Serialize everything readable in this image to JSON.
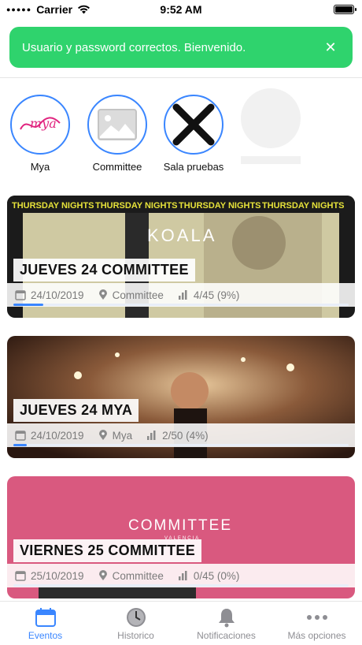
{
  "status_bar": {
    "carrier": "Carrier",
    "time": "9:52 AM"
  },
  "toast": {
    "message": "Usuario y password correctos. Bienvenido.",
    "close_icon": "close-icon"
  },
  "venues": [
    {
      "label": "Mya",
      "logo_text": "mya"
    },
    {
      "label": "Committee"
    },
    {
      "label": "Sala pruebas"
    }
  ],
  "events": [
    {
      "title": "JUEVES 24 COMMITTEE",
      "date": "24/10/2019",
      "venue": "Committee",
      "attendance": "4/45 (9%)",
      "progress": 0.09,
      "banner_text": "THURSDAY NIGHTS",
      "brand": "KOALA"
    },
    {
      "title": "JUEVES 24 MYA",
      "date": "24/10/2019",
      "venue": "Mya",
      "attendance": "2/50 (4%)",
      "progress": 0.04
    },
    {
      "title": "VIERNES 25 COMMITTEE",
      "date": "25/10/2019",
      "venue": "Committee",
      "attendance": "0/45 (0%)",
      "progress": 0.0,
      "brand": "COMMITTEE",
      "brand_sub": "VALENCIA"
    }
  ],
  "tabs": [
    {
      "label": "Eventos",
      "icon": "calendar-icon",
      "active": true
    },
    {
      "label": "Historico",
      "icon": "clock-icon",
      "active": false
    },
    {
      "label": "Notificaciones",
      "icon": "bell-icon",
      "active": false
    },
    {
      "label": "Más opciones",
      "icon": "more-icon",
      "active": false
    }
  ],
  "colors": {
    "accent": "#3a86ff",
    "success": "#2fd36d",
    "event3_bg": "#d9597f"
  }
}
